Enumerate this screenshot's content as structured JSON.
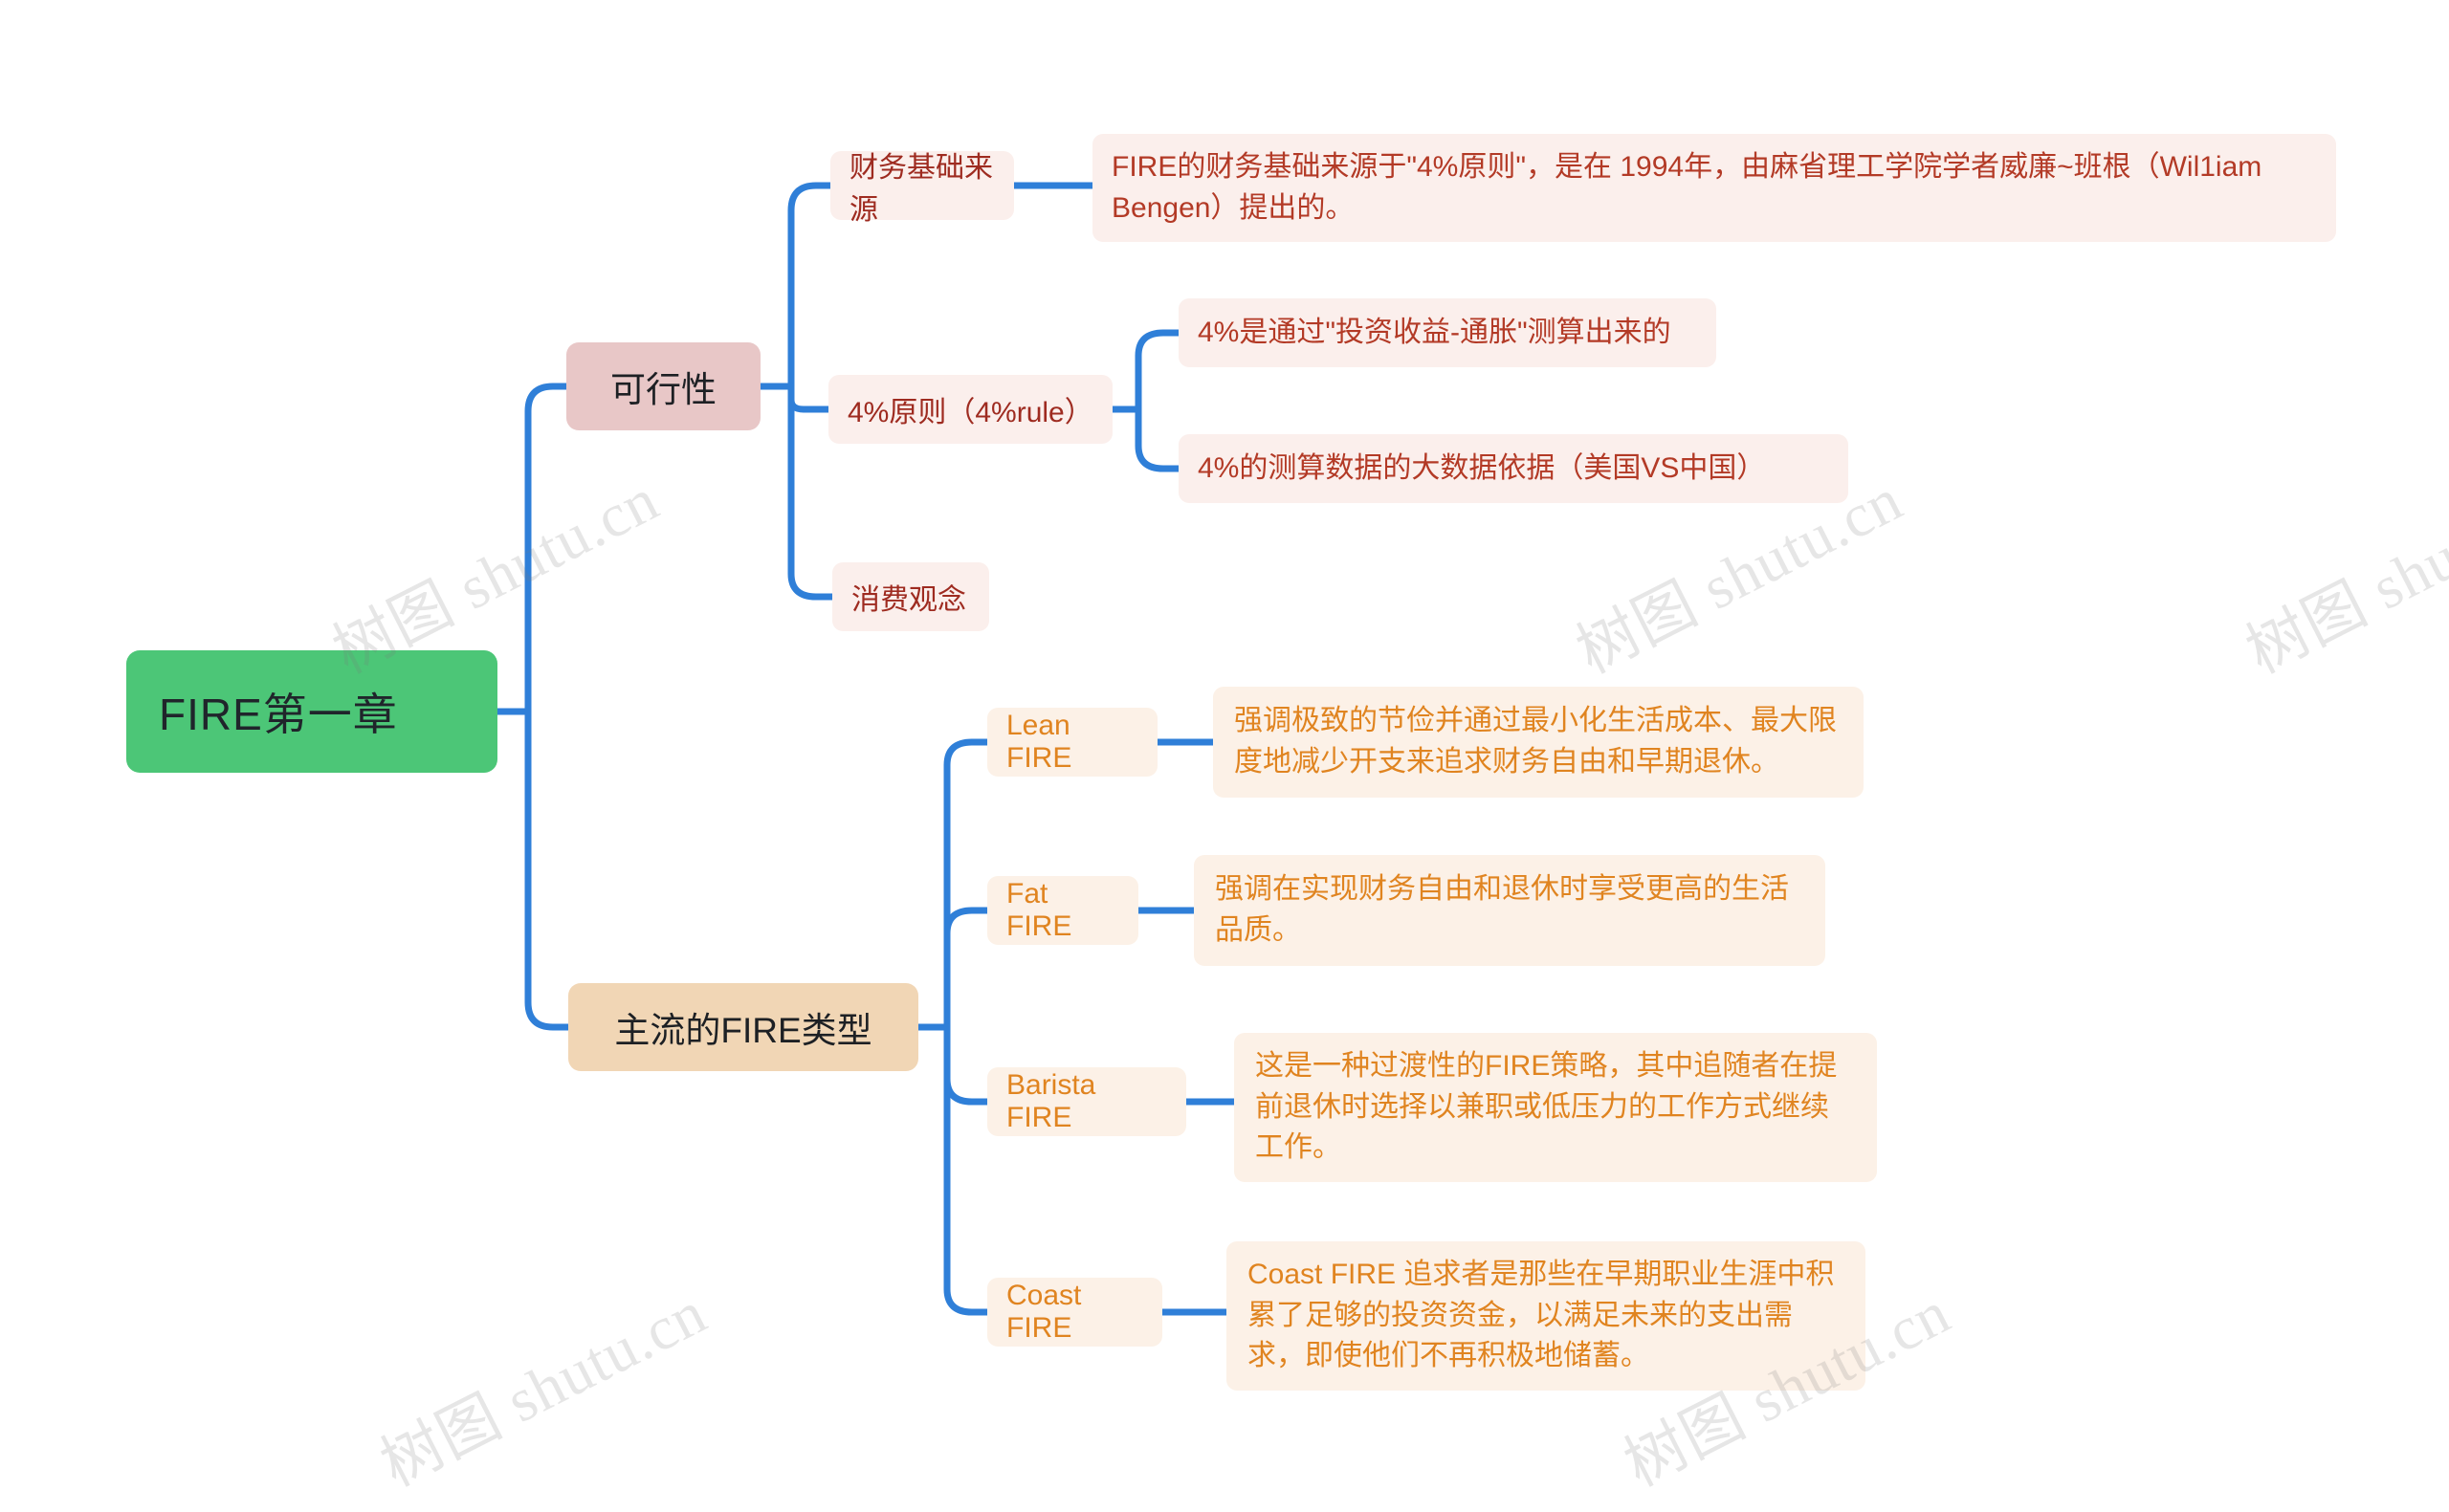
{
  "theme": {
    "background": "#ffffff",
    "edge_color": "#2f7fd8",
    "root_fill": "#4cc677",
    "root_text": "#20252b",
    "branch1_fill": "#e8c7c7",
    "branch2_fill": "#f1d6b5",
    "leaf_red_fill": "#fbefec",
    "leaf_red_text": "#b33a26",
    "leaf_orange_fill": "#fcf1e7",
    "leaf_orange_text": "#e08420",
    "watermark_color": "#787878"
  },
  "watermark": {
    "text": "树图 shutu.cn"
  },
  "mindmap": {
    "root": {
      "label": "FIRE第一章"
    },
    "branches": [
      {
        "label": "可行性",
        "children": [
          {
            "label": "财务基础来源",
            "children": [
              {
                "label": "FIRE的财务基础来源于\"4%原则\"，是在 1994年，由麻省理工学院学者威廉~班根（Wil1iam Bengen）提出的。"
              }
            ]
          },
          {
            "label": "4%原则（4%rule）",
            "children": [
              {
                "label": "4%是通过\"投资收益-通胀\"测算出来的"
              },
              {
                "label": "4%的测算数据的大数据依据（美国VS中国）"
              }
            ]
          },
          {
            "label": "消费观念",
            "children": []
          }
        ]
      },
      {
        "label": "主流的FIRE类型",
        "children": [
          {
            "label": "Lean FIRE",
            "children": [
              {
                "label": "强调极致的节俭并通过最小化生活成本、最大限度地减少开支来追求财务自由和早期退休。"
              }
            ]
          },
          {
            "label": "Fat FIRE",
            "children": [
              {
                "label": "强调在实现财务自由和退休时享受更高的生活品质。"
              }
            ]
          },
          {
            "label": "Barista FIRE",
            "children": [
              {
                "label": "这是一种过渡性的FIRE策略，其中追随者在提前退休时选择以兼职或低压力的工作方式继续工作。"
              }
            ]
          },
          {
            "label": "Coast FIRE",
            "children": [
              {
                "label": "Coast FIRE 追求者是那些在早期职业生涯中积累了足够的投资资金，以满足未来的支出需求，即使他们不再积极地储蓄。"
              }
            ]
          }
        ]
      }
    ]
  }
}
